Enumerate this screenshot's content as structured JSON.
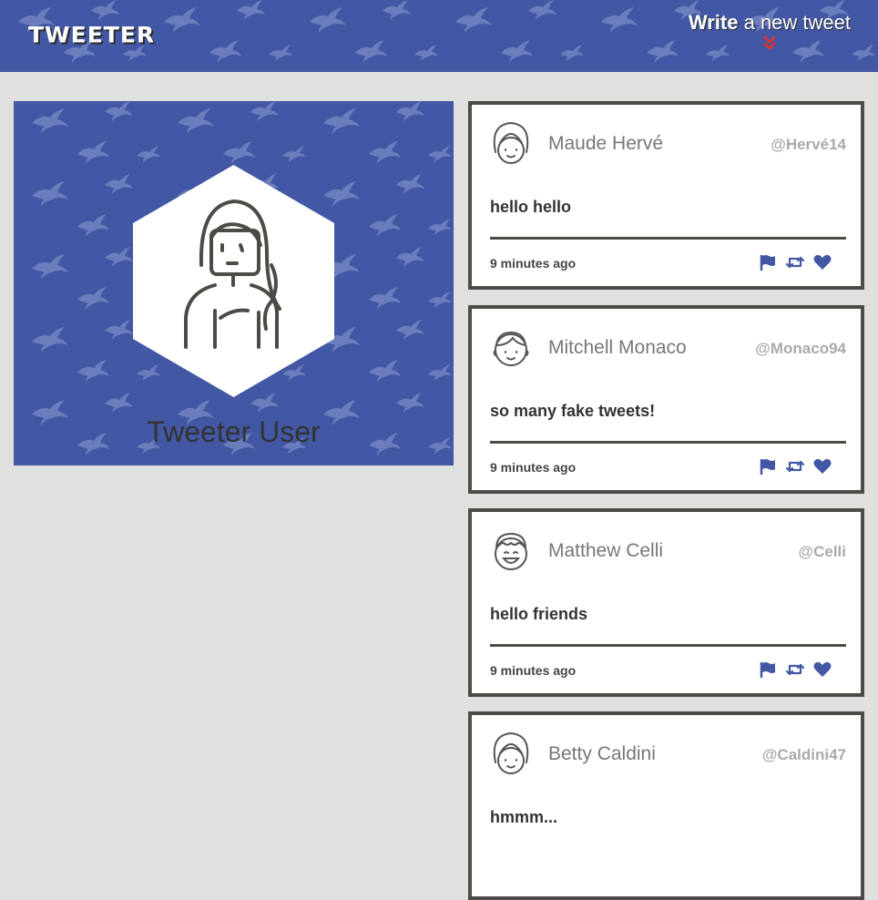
{
  "nav": {
    "logo": "TWEETER",
    "compose_bold": "Write",
    "compose_rest": " a new tweet",
    "compose_icon": "double-chevron-down-icon"
  },
  "profile": {
    "name": "Tweeter User",
    "avatar_icon": "girl-avatar-icon"
  },
  "colors": {
    "brand": "#4358a4",
    "page_bg": "#e0e0de",
    "card_border": "#4c4b45",
    "chevron": "#e8302a"
  },
  "tweets": [
    {
      "name": "Maude Hervé",
      "handle": "@Hervé14",
      "content": "hello hello",
      "time": "9 minutes ago",
      "avatar_icon": "girl-bob-avatar-icon"
    },
    {
      "name": "Mitchell Monaco",
      "handle": "@Monaco94",
      "content": "so many fake tweets!",
      "time": "9 minutes ago",
      "avatar_icon": "boy-avatar-icon"
    },
    {
      "name": "Matthew Celli",
      "handle": "@Celli",
      "content": "hello friends",
      "time": "9 minutes ago",
      "avatar_icon": "laughing-boy-avatar-icon"
    },
    {
      "name": "Betty Caldini",
      "handle": "@Caldini47",
      "content": "hmmm...",
      "time": "",
      "avatar_icon": "girl-bob-avatar-icon"
    }
  ],
  "tweet_actions": [
    "flag-icon",
    "retweet-icon",
    "heart-icon"
  ]
}
